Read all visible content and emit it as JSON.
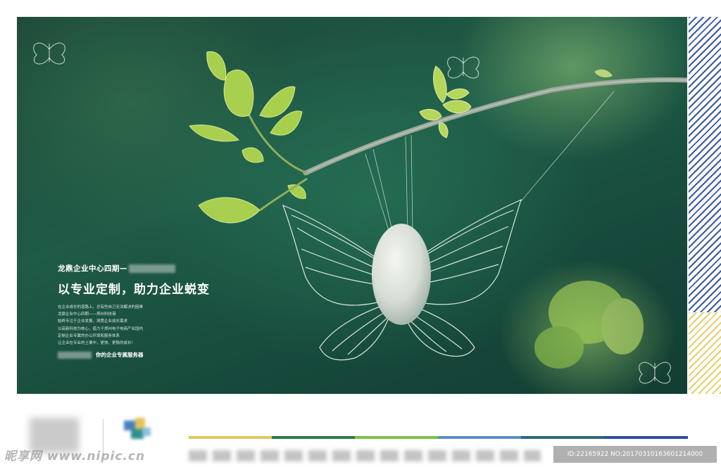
{
  "poster": {
    "overline": "龙鼎企业中心四期—",
    "headline": "以专业定制，助力企业蜕变",
    "body_lines": [
      "在企业成长的道路上，总有些自己无法解决的困难",
      "龙鼎企业中心四期——郑州科技港",
      "始终专注于企业发展，洞悉企业成长需求",
      "以高新科技为核心，借力于郑州电子电商产业园内",
      "定制企业专属的办公环境和服务体系",
      "让企业在专业的土壤中，更快、更稳的成长！"
    ],
    "tagline": "你的企业专属服务器"
  },
  "footer": {
    "color_bars": [
      "#e2c65e",
      "#2a7a4a",
      "#7fbf4a",
      "#5b8fc7",
      "#2a6a7a",
      "#2a4f9e"
    ]
  },
  "watermarks": {
    "left": "昵享网 www.nipic.cn",
    "right": "ID:22165922 NO:20170310163601214000"
  },
  "icons": [
    "butterfly-icon",
    "leaf-sprig",
    "cocoon"
  ]
}
